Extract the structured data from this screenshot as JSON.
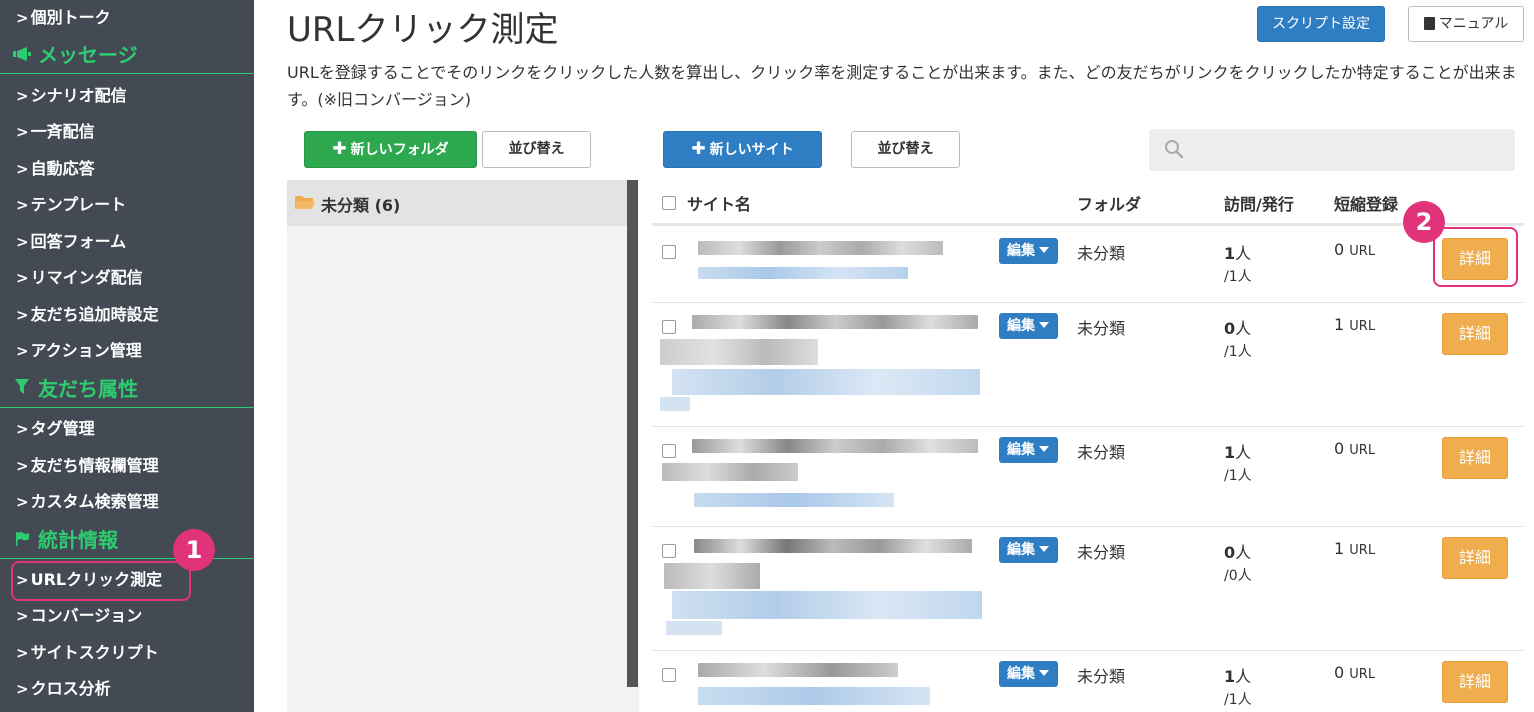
{
  "sidebar": {
    "items_top": [
      {
        "label": "個別トーク"
      }
    ],
    "sections": [
      {
        "title": "メッセージ",
        "icon": "megaphone-icon",
        "items": [
          "シナリオ配信",
          "一斉配信",
          "自動応答",
          "テンプレート",
          "回答フォーム",
          "リマインダ配信",
          "友だち追加時設定",
          "アクション管理"
        ]
      },
      {
        "title": "友だち属性",
        "icon": "filter-icon",
        "items": [
          "タグ管理",
          "友だち情報欄管理",
          "カスタム検索管理"
        ]
      },
      {
        "title": "統計情報",
        "icon": "flag-icon",
        "items": [
          "URLクリック測定",
          "コンバージョン",
          "サイトスクリプト",
          "クロス分析"
        ]
      }
    ],
    "active_item": "URLクリック測定",
    "callout_1": "1"
  },
  "header": {
    "title": "URLクリック測定",
    "script_button": "スクリプト設定",
    "manual_button": "マニュアル",
    "description": "URLを登録することでそのリンクをクリックした人数を算出し、クリック率を測定することが出来ます。また、どの友だちがリンクをクリックしたか特定することが出来ます。(※旧コンバージョン)"
  },
  "toolbar": {
    "new_folder": "新しいフォルダ",
    "sort_folders": "並び替え",
    "new_site": "新しいサイト",
    "sort_sites": "並び替え",
    "search_placeholder": ""
  },
  "folders": [
    {
      "label": "未分類 (6)"
    }
  ],
  "table": {
    "columns": {
      "site_name": "サイト名",
      "folder": "フォルダ",
      "visits": "訪問/発行",
      "short": "短縮登録"
    },
    "edit_label": "編集",
    "detail_label": "詳細",
    "callout_2": "2",
    "rows": [
      {
        "folder": "未分類",
        "visits": "1",
        "visits_unit": "人",
        "issued": "/1人",
        "short": "0",
        "short_unit": "URL"
      },
      {
        "folder": "未分類",
        "visits": "0",
        "visits_unit": "人",
        "issued": "/1人",
        "short": "1",
        "short_unit": "URL"
      },
      {
        "folder": "未分類",
        "visits": "1",
        "visits_unit": "人",
        "issued": "/1人",
        "short": "0",
        "short_unit": "URL"
      },
      {
        "folder": "未分類",
        "visits": "0",
        "visits_unit": "人",
        "issued": "/0人",
        "short": "1",
        "short_unit": "URL"
      },
      {
        "folder": "未分類",
        "visits": "1",
        "visits_unit": "人",
        "issued": "/1人",
        "short": "0",
        "short_unit": "URL"
      }
    ]
  },
  "colors": {
    "sidebar_bg": "#434a54",
    "section_green": "#2ecc71",
    "primary_blue": "#2f7ec4",
    "detail_orange": "#f0ad4e",
    "callout_pink": "#e0337a"
  }
}
